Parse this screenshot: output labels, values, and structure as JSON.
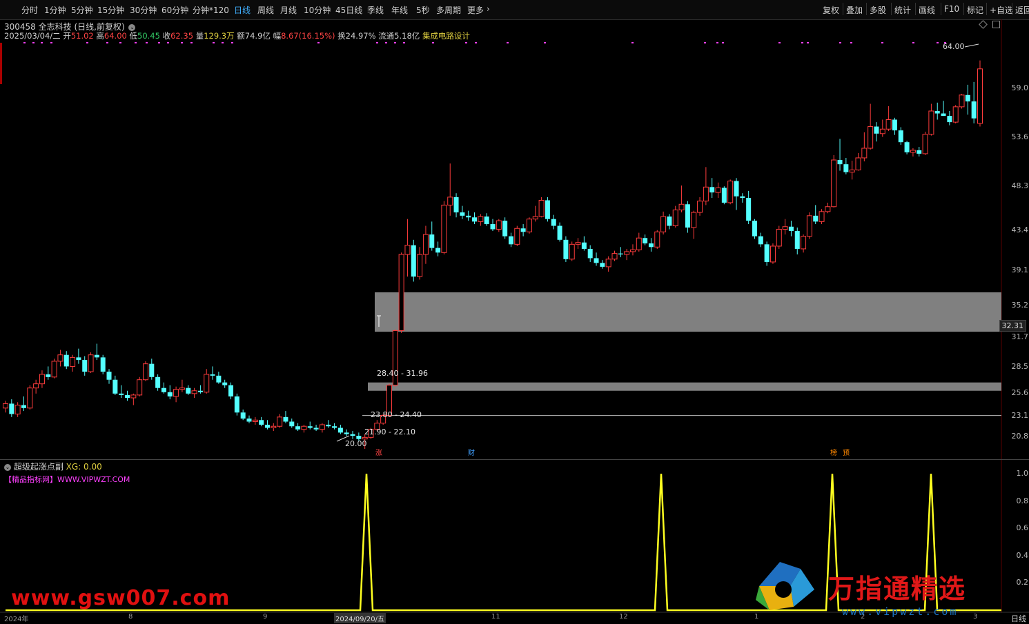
{
  "toolbar": {
    "periods": [
      "分时",
      "1分钟",
      "5分钟",
      "15分钟",
      "30分钟",
      "60分钟",
      "分钟*120",
      "日线",
      "周线",
      "月线",
      "10分钟",
      "45日线",
      "季线",
      "年线",
      "5秒",
      "多周期",
      "更多"
    ],
    "active": "日线",
    "right_items": [
      "复权",
      "叠加",
      "多股",
      "统计",
      "画线",
      "F10",
      "标记",
      "+自选",
      "返回"
    ]
  },
  "stock": {
    "code_name": "300458 全志科技",
    "period_note": "(日线,前复权)",
    "date": "2025/03/04/二",
    "open_label": "开",
    "open": "51.02",
    "high_label": "高",
    "high": "64.00",
    "low_label": "低",
    "low": "50.45",
    "close_label": "收",
    "close": "62.35",
    "vol_label": "量",
    "vol": "129.3万",
    "amt_label": "额",
    "amt": "74.9亿",
    "chg_label": "幅",
    "chg": "8.67(16.15%)",
    "turn_label": "换",
    "turn": "24.97%",
    "float_label": "流通",
    "float": "5.18亿",
    "sector": "集成电路设计"
  },
  "price_axis": [
    "59.0",
    "53.6",
    "48.3",
    "43.4",
    "39.1",
    "35.2",
    "31.7",
    "28.5",
    "25.6",
    "23.1",
    "20.8"
  ],
  "current_price_tag": "32.31",
  "peak_label": "64.00",
  "low_label": "20.00",
  "zones": [
    "28.40 - 31.96",
    "23.80 - 24.40",
    "21.90 - 22.10"
  ],
  "event_badges": [
    {
      "text": "涨",
      "color": "#ff4444"
    },
    {
      "text": "财",
      "color": "#40a0ff"
    },
    {
      "text": "榜",
      "color": "#ff8800"
    },
    {
      "text": "预",
      "color": "#ff8800"
    }
  ],
  "indicator": {
    "name": "超级起涨点副",
    "value_label": "XG: 0.00",
    "promo": "【精品指标网】WWW.VIPWZT.COM",
    "axis": [
      "1.0",
      "0.8",
      "0.6",
      "0.4",
      "0.2"
    ]
  },
  "date_axis": [
    "2024年",
    "8",
    "9",
    "2024/09/20/五",
    "11",
    "12",
    "1",
    "2",
    "3"
  ],
  "corner_label": "日线",
  "watermarks": {
    "left": "www.gsw007.com",
    "right_big": "万指通精选",
    "right_url": "www.vipwzt.com"
  },
  "chart_data": {
    "type": "candlestick",
    "title": "300458 全志科技 (日线,前复权)",
    "ylim": [
      20.0,
      64.5
    ],
    "ohlc": [
      [
        22.6,
        23.1,
        22.3,
        22.9
      ],
      [
        22.9,
        23.2,
        22.0,
        22.2
      ],
      [
        22.2,
        23.0,
        22.0,
        22.8
      ],
      [
        22.8,
        23.4,
        22.4,
        22.6
      ],
      [
        22.6,
        24.2,
        22.5,
        24.0
      ],
      [
        24.0,
        24.6,
        23.6,
        24.3
      ],
      [
        24.3,
        25.3,
        24.0,
        25.0
      ],
      [
        25.0,
        25.6,
        24.6,
        24.8
      ],
      [
        24.8,
        26.2,
        24.7,
        26.0
      ],
      [
        26.0,
        26.9,
        25.6,
        26.5
      ],
      [
        26.5,
        26.8,
        25.4,
        25.6
      ],
      [
        25.6,
        26.5,
        25.2,
        26.3
      ],
      [
        26.3,
        27.0,
        25.8,
        26.1
      ],
      [
        26.1,
        26.4,
        24.9,
        25.2
      ],
      [
        25.2,
        26.7,
        25.1,
        26.5
      ],
      [
        26.5,
        27.4,
        26.1,
        26.3
      ],
      [
        26.3,
        26.5,
        25.0,
        25.2
      ],
      [
        25.2,
        25.4,
        24.3,
        24.6
      ],
      [
        24.6,
        24.9,
        23.5,
        23.6
      ],
      [
        23.6,
        24.2,
        23.3,
        23.5
      ],
      [
        23.5,
        23.8,
        23.1,
        23.3
      ],
      [
        23.3,
        23.6,
        22.8,
        23.5
      ],
      [
        23.5,
        24.8,
        23.4,
        24.6
      ],
      [
        24.6,
        26.0,
        24.5,
        25.8
      ],
      [
        25.8,
        26.2,
        24.6,
        24.8
      ],
      [
        24.8,
        25.0,
        23.8,
        24.0
      ],
      [
        24.0,
        24.4,
        23.6,
        23.7
      ],
      [
        23.7,
        24.2,
        23.2,
        23.4
      ],
      [
        23.4,
        24.1,
        23.0,
        23.9
      ],
      [
        23.9,
        24.6,
        23.7,
        24.0
      ],
      [
        24.0,
        24.2,
        23.5,
        23.6
      ],
      [
        23.6,
        24.0,
        23.3,
        23.8
      ],
      [
        23.8,
        24.2,
        23.6,
        23.7
      ],
      [
        23.7,
        25.4,
        23.6,
        25.0
      ],
      [
        25.0,
        25.6,
        24.6,
        24.9
      ],
      [
        24.9,
        25.2,
        24.3,
        24.4
      ],
      [
        24.4,
        24.6,
        24.0,
        24.2
      ],
      [
        24.2,
        24.4,
        23.2,
        23.4
      ],
      [
        23.4,
        23.6,
        22.1,
        22.3
      ],
      [
        22.3,
        22.5,
        21.8,
        21.9
      ],
      [
        21.9,
        22.1,
        21.6,
        21.7
      ],
      [
        21.7,
        22.0,
        21.5,
        21.8
      ],
      [
        21.8,
        22.0,
        21.4,
        21.5
      ],
      [
        21.5,
        21.8,
        21.2,
        21.3
      ],
      [
        21.3,
        21.6,
        21.1,
        21.4
      ],
      [
        21.4,
        22.2,
        21.3,
        22.0
      ],
      [
        22.0,
        22.4,
        21.6,
        21.7
      ],
      [
        21.7,
        21.9,
        21.3,
        21.4
      ],
      [
        21.4,
        21.6,
        21.1,
        21.2
      ],
      [
        21.2,
        21.5,
        21.0,
        21.4
      ],
      [
        21.4,
        21.7,
        21.2,
        21.3
      ],
      [
        21.3,
        21.5,
        21.1,
        21.2
      ],
      [
        21.2,
        21.6,
        21.0,
        21.5
      ],
      [
        21.5,
        21.8,
        21.3,
        21.4
      ],
      [
        21.4,
        21.6,
        21.2,
        21.3
      ],
      [
        21.3,
        21.5,
        20.9,
        21.0
      ],
      [
        21.0,
        21.2,
        20.8,
        20.9
      ],
      [
        20.9,
        21.1,
        20.6,
        20.8
      ],
      [
        20.8,
        21.0,
        20.5,
        20.6
      ],
      [
        20.6,
        20.9,
        20.0,
        20.7
      ],
      [
        20.7,
        21.3,
        20.6,
        21.2
      ],
      [
        21.2,
        21.8,
        21.1,
        21.6
      ],
      [
        21.6,
        22.2,
        21.5,
        22.1
      ],
      [
        22.1,
        24.3,
        22.0,
        24.2
      ],
      [
        24.2,
        28.6,
        24.1,
        28.5
      ],
      [
        28.5,
        36.0,
        28.3,
        35.8
      ],
      [
        35.8,
        39.8,
        33.5,
        36.8
      ],
      [
        36.8,
        37.4,
        33.0,
        33.5
      ],
      [
        33.5,
        36.6,
        33.2,
        35.8
      ],
      [
        35.8,
        39.0,
        34.8,
        38.0
      ],
      [
        38.0,
        39.5,
        36.2,
        36.5
      ],
      [
        36.5,
        37.2,
        35.6,
        36.0
      ],
      [
        36.0,
        42.0,
        35.8,
        41.5
      ],
      [
        41.5,
        47.0,
        40.2,
        42.5
      ],
      [
        42.5,
        43.0,
        40.0,
        40.6
      ],
      [
        40.6,
        41.4,
        39.8,
        40.2
      ],
      [
        40.2,
        40.8,
        39.6,
        40.0
      ],
      [
        40.0,
        40.6,
        39.2,
        39.5
      ],
      [
        39.5,
        40.4,
        39.0,
        40.1
      ],
      [
        40.1,
        40.5,
        39.0,
        39.2
      ],
      [
        39.2,
        39.8,
        38.4,
        38.6
      ],
      [
        38.6,
        39.8,
        38.3,
        39.6
      ],
      [
        39.6,
        40.0,
        37.5,
        37.8
      ],
      [
        37.8,
        38.2,
        36.6,
        36.9
      ],
      [
        36.9,
        39.0,
        36.7,
        38.7
      ],
      [
        38.7,
        39.2,
        37.8,
        38.3
      ],
      [
        38.3,
        40.0,
        38.1,
        39.8
      ],
      [
        39.8,
        41.4,
        39.5,
        40.1
      ],
      [
        40.1,
        42.5,
        40.0,
        42.1
      ],
      [
        42.1,
        42.5,
        39.5,
        39.8
      ],
      [
        39.8,
        40.3,
        38.6,
        39.0
      ],
      [
        39.0,
        39.4,
        37.2,
        37.4
      ],
      [
        37.4,
        37.8,
        35.0,
        35.3
      ],
      [
        35.3,
        37.2,
        35.1,
        36.9
      ],
      [
        36.9,
        37.6,
        36.4,
        37.1
      ],
      [
        37.1,
        37.8,
        36.2,
        36.4
      ],
      [
        36.4,
        36.8,
        35.0,
        35.4
      ],
      [
        35.4,
        36.0,
        34.6,
        34.9
      ],
      [
        34.9,
        35.2,
        34.3,
        34.5
      ],
      [
        34.5,
        35.6,
        34.0,
        35.3
      ],
      [
        35.3,
        36.2,
        35.1,
        35.9
      ],
      [
        35.9,
        36.6,
        35.5,
        35.8
      ],
      [
        35.8,
        36.4,
        35.2,
        36.1
      ],
      [
        36.1,
        36.9,
        35.7,
        36.3
      ],
      [
        36.3,
        38.2,
        36.1,
        37.6
      ],
      [
        37.6,
        38.0,
        36.8,
        37.0
      ],
      [
        37.0,
        37.6,
        36.1,
        36.6
      ],
      [
        36.6,
        38.5,
        36.4,
        38.3
      ],
      [
        38.3,
        40.7,
        38.0,
        40.1
      ],
      [
        40.1,
        40.4,
        38.6,
        39.0
      ],
      [
        39.0,
        41.4,
        38.8,
        40.9
      ],
      [
        40.9,
        44.0,
        40.6,
        41.6
      ],
      [
        41.6,
        42.0,
        38.2,
        38.8
      ],
      [
        38.8,
        40.8,
        37.5,
        40.6
      ],
      [
        40.6,
        42.5,
        40.2,
        42.0
      ],
      [
        42.0,
        46.5,
        41.5,
        43.8
      ],
      [
        43.8,
        45.0,
        42.4,
        43.1
      ],
      [
        43.1,
        44.4,
        42.4,
        43.7
      ],
      [
        43.7,
        43.9,
        41.6,
        41.8
      ],
      [
        41.8,
        44.8,
        41.6,
        44.6
      ],
      [
        44.6,
        45.0,
        40.9,
        42.6
      ],
      [
        42.6,
        43.0,
        41.8,
        42.4
      ],
      [
        42.4,
        43.3,
        39.2,
        39.6
      ],
      [
        39.6,
        39.8,
        37.5,
        37.8
      ],
      [
        37.8,
        38.2,
        36.6,
        36.9
      ],
      [
        36.9,
        37.2,
        34.6,
        35.0
      ],
      [
        35.0,
        37.0,
        34.8,
        36.7
      ],
      [
        36.7,
        39.0,
        36.4,
        38.6
      ],
      [
        38.6,
        39.8,
        38.0,
        38.9
      ],
      [
        38.9,
        39.6,
        37.8,
        38.4
      ],
      [
        38.4,
        38.8,
        35.8,
        36.4
      ],
      [
        36.4,
        38.0,
        36.0,
        37.8
      ],
      [
        37.8,
        40.6,
        37.5,
        40.2
      ],
      [
        40.2,
        41.5,
        39.2,
        39.5
      ],
      [
        39.5,
        41.0,
        39.2,
        40.7
      ],
      [
        40.7,
        41.8,
        40.5,
        41.3
      ],
      [
        41.3,
        48.2,
        41.2,
        47.5
      ],
      [
        47.5,
        50.6,
        46.0,
        46.9
      ],
      [
        46.9,
        47.8,
        45.5,
        45.8
      ],
      [
        45.8,
        47.4,
        44.8,
        46.1
      ],
      [
        46.1,
        48.5,
        46.0,
        47.8
      ],
      [
        47.8,
        51.6,
        47.3,
        49.2
      ],
      [
        49.2,
        56.2,
        49.0,
        52.5
      ],
      [
        52.5,
        53.2,
        50.2,
        51.4
      ],
      [
        51.4,
        53.6,
        50.9,
        52.1
      ],
      [
        52.1,
        55.8,
        51.8,
        53.6
      ],
      [
        53.6,
        53.9,
        51.2,
        51.9
      ],
      [
        51.9,
        52.4,
        49.7,
        50.1
      ],
      [
        50.1,
        50.3,
        48.3,
        48.6
      ],
      [
        48.6,
        49.2,
        48.0,
        48.9
      ],
      [
        48.9,
        49.4,
        48.0,
        48.4
      ],
      [
        48.4,
        51.7,
        48.2,
        51.3
      ],
      [
        51.3,
        56.2,
        51.1,
        55.0
      ],
      [
        55.0,
        56.4,
        53.6,
        54.6
      ],
      [
        54.6,
        56.7,
        54.2,
        54.2
      ],
      [
        54.2,
        55.0,
        52.7,
        53.2
      ],
      [
        53.2,
        56.0,
        53.0,
        55.7
      ],
      [
        55.7,
        57.9,
        55.4,
        57.7
      ],
      [
        57.7,
        59.5,
        54.4,
        56.6
      ],
      [
        56.6,
        60.0,
        53.0,
        53.8
      ],
      [
        53.0,
        64.0,
        52.5,
        62.4
      ]
    ],
    "zones": [
      {
        "low": 28.4,
        "high": 31.96,
        "label": "28.40 - 31.96"
      },
      {
        "low": 23.8,
        "high": 24.4,
        "label": "23.80 - 24.40"
      },
      {
        "low": 21.9,
        "high": 22.1,
        "label": "21.90 - 22.10"
      }
    ],
    "indicator_series": {
      "name": "XG",
      "spikes_at_index": [
        63,
        114,
        147,
        160
      ],
      "ymax": 1.0
    }
  }
}
